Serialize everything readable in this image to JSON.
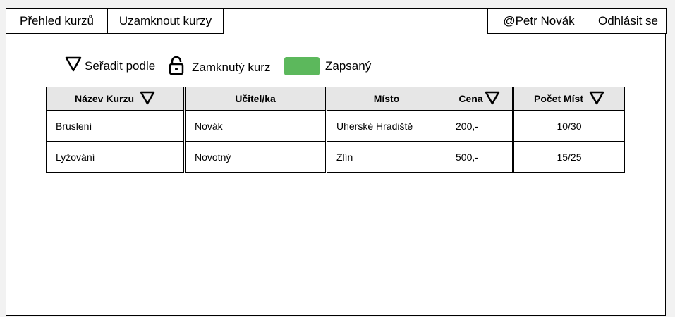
{
  "nav": {
    "course_overview": "Přehled kurzů",
    "lock_courses": "Uzamknout kurzy",
    "user": "@Petr Novák",
    "logout": "Odhlásit se"
  },
  "legend": {
    "sort_by": "Seřadit podle",
    "locked_course": "Zamknutý kurz",
    "enrolled": "Zapsaný",
    "enrolled_color": "#5cb85c",
    "sort_icon": "triangle-down-icon",
    "lock_icon": "lock-icon"
  },
  "table": {
    "headers": {
      "name": "Název Kurzu",
      "teacher": "Učitel/ka",
      "place": "Místo",
      "price": "Cena",
      "seats": "Počet Míst"
    },
    "rows": [
      {
        "name": "Bruslení",
        "teacher": "Novák",
        "place": "Uherské Hradiště",
        "price": "200,-",
        "seats": "10/30"
      },
      {
        "name": "Lyžování",
        "teacher": "Novotný",
        "place": "Zlín",
        "price": "500,-",
        "seats": "15/25"
      }
    ]
  }
}
